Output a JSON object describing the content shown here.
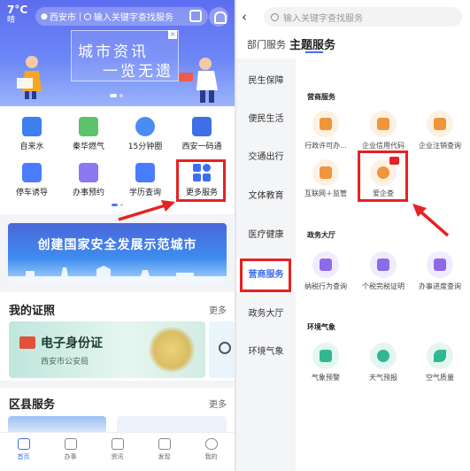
{
  "left": {
    "weather": {
      "temp": "7°C",
      "cond": "晴"
    },
    "search": {
      "city": "西安市",
      "placeholder": "输入关键字查找服务"
    },
    "banner": {
      "title": "城市资讯",
      "subtitle": "一览无遗"
    },
    "grid": [
      {
        "label": "自来水",
        "color": "#3d7ef0"
      },
      {
        "label": "秦华燃气",
        "color": "#5cc36a"
      },
      {
        "label": "15分钟圈",
        "color": "#4a8cf5"
      },
      {
        "label": "西安一码通",
        "color": "#3f6fe6"
      },
      {
        "label": "停车诱导",
        "color": "#4a7cff"
      },
      {
        "label": "办事预约",
        "color": "#8c78f0"
      },
      {
        "label": "学历查询",
        "color": "#4a7cff"
      },
      {
        "label": "更多服务",
        "color": "#3c6ff0"
      }
    ],
    "city_banner": "创建国家安全发展示范城市",
    "certs": {
      "title": "我的证照",
      "more": "更多",
      "card_name": "电子身份证",
      "card_dept": "西安市公安局"
    },
    "district": {
      "title": "区县服务",
      "more": "更多"
    },
    "tabs": [
      "首页",
      "办事",
      "资讯",
      "发现",
      "我的"
    ]
  },
  "right": {
    "search_placeholder": "输入关键字查找服务",
    "tabs": {
      "dept": "部门服务",
      "theme": "主题服务"
    },
    "sidebar": [
      "民生保障",
      "便民生活",
      "交通出行",
      "文体教育",
      "医疗健康",
      "营商服务",
      "政务大厅",
      "环境气象"
    ],
    "sections": [
      {
        "title": "营商服务",
        "items": [
          "行政许可办...",
          "企业信用代码",
          "企业注销查询",
          "互联网＋监管",
          "爱企查"
        ]
      },
      {
        "title": "政务大厅",
        "items": [
          "纳税行为查询",
          "个税完税证明",
          "办事进度查询"
        ]
      },
      {
        "title": "环境气象",
        "items": [
          "气象预警",
          "天气预报",
          "空气质量"
        ]
      }
    ]
  },
  "colors": {
    "accent": "#3c6ff0",
    "highlight": "#e52222"
  }
}
